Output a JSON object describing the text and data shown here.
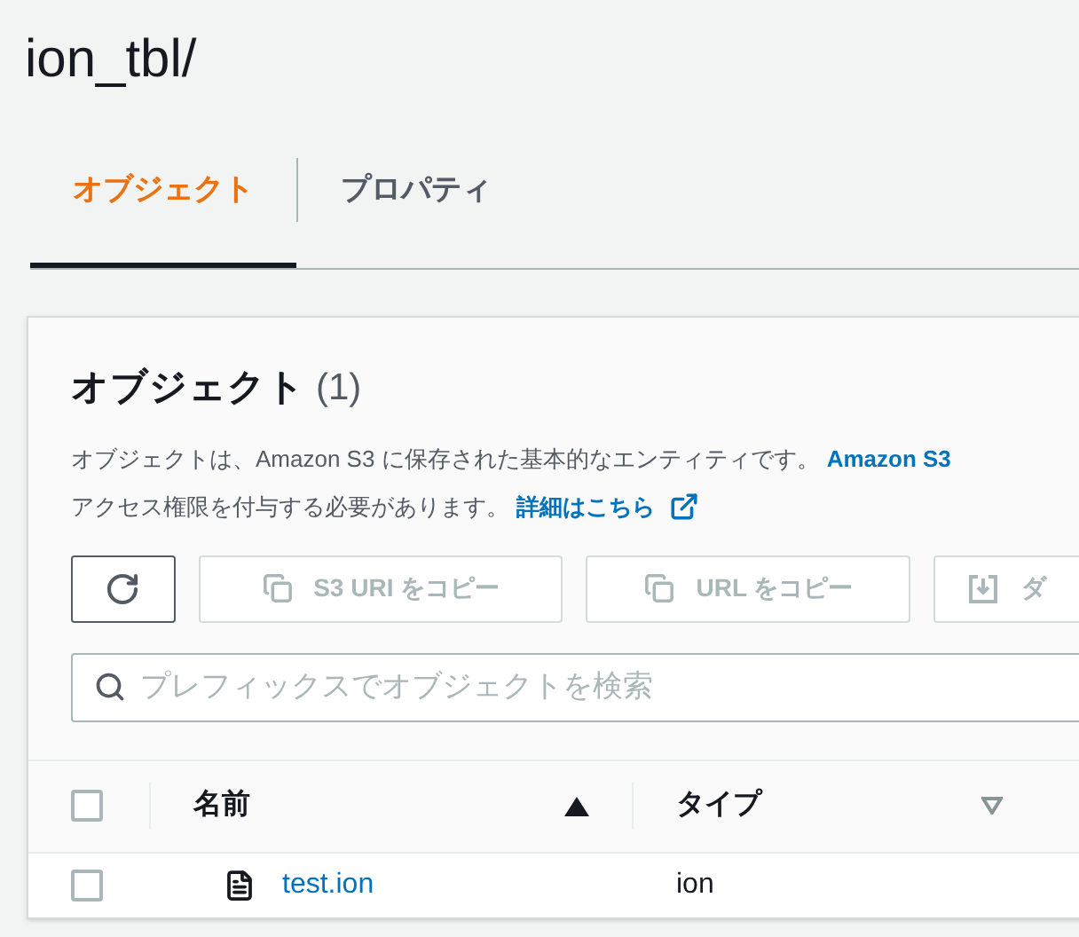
{
  "title": "ion_tbl/",
  "tabs": [
    {
      "label": "オブジェクト",
      "selected": true
    },
    {
      "label": "プロパティ",
      "selected": false
    }
  ],
  "panel": {
    "heading": "オブジェクト",
    "count": "(1)",
    "description": [
      [
        {
          "kind": "text",
          "text": "オブジェクトは、Amazon S3 に保存された基本的なエンティティです。"
        },
        {
          "kind": "link",
          "text": "Amazon S3"
        }
      ],
      [
        {
          "kind": "text",
          "text": "アクセス権限を付与する必要があります。"
        },
        {
          "kind": "external_link",
          "text": "詳細はこちら"
        }
      ]
    ],
    "buttons": [
      {
        "kind": "refresh",
        "disabled": false
      },
      {
        "kind": "copy",
        "label": "S3 URI をコピー",
        "disabled": true
      },
      {
        "kind": "copy",
        "label": "URL をコピー",
        "disabled": true
      },
      {
        "kind": "download",
        "label": "ダ",
        "disabled": true
      }
    ],
    "search": {
      "placeholder": "プレフィックスでオブジェクトを検索"
    },
    "table": {
      "select_all": {
        "checked": false
      },
      "columns": [
        {
          "label": "名前",
          "kind": "sorted"
        },
        {
          "label": "タイプ",
          "kind": "sortable"
        }
      ],
      "rows": [
        {
          "selected": false,
          "name": "test.ion",
          "type": "ion"
        }
      ]
    }
  }
}
